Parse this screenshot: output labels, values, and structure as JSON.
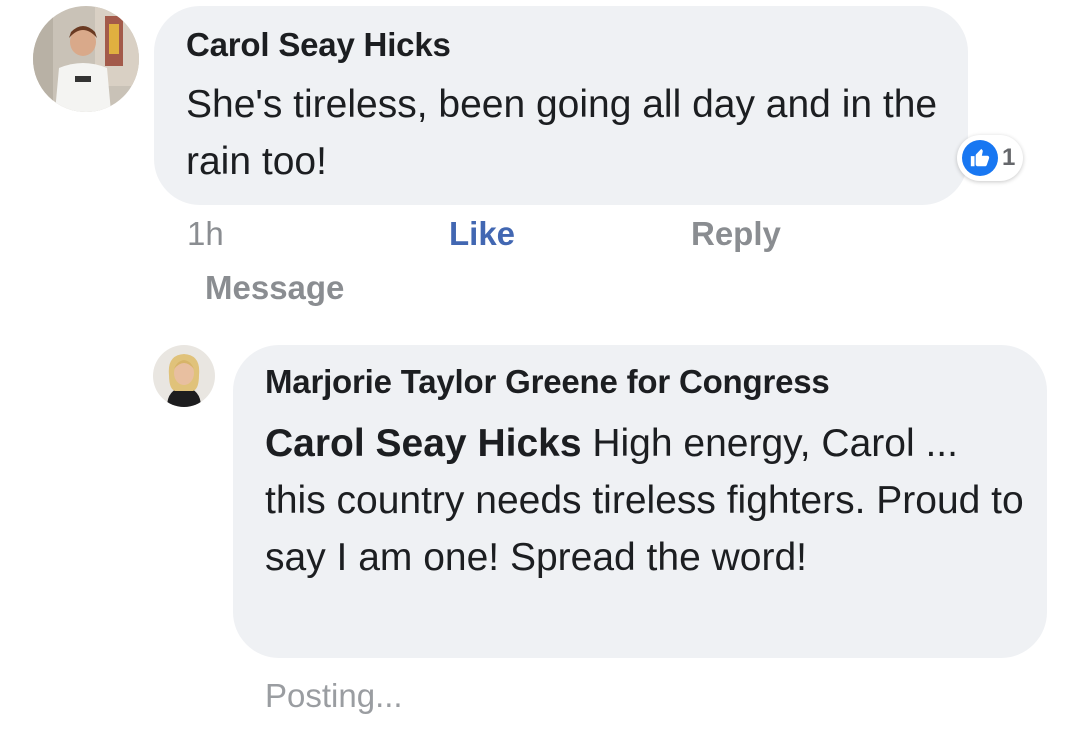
{
  "comment": {
    "author": "Carol Seay Hicks",
    "text": "She's tireless, been going all day and in the rain too!",
    "reaction_count": "1",
    "time": "1h",
    "like_label": "Like",
    "reply_label": "Reply",
    "message_label": "Message"
  },
  "reply": {
    "author": "Marjorie Taylor Greene for Congress",
    "tag": "Carol Seay Hicks",
    "text": " High energy, Carol ... this country needs tireless fighters. Proud to say I am one! Spread the word!",
    "status": "Posting..."
  },
  "colors": {
    "bubble": "#eff1f4",
    "like_blue": "#4267b2",
    "reaction_blue": "#1877f2",
    "meta_gray": "#8a8d91"
  },
  "icons": {
    "reaction": "thumbs-up-icon"
  }
}
